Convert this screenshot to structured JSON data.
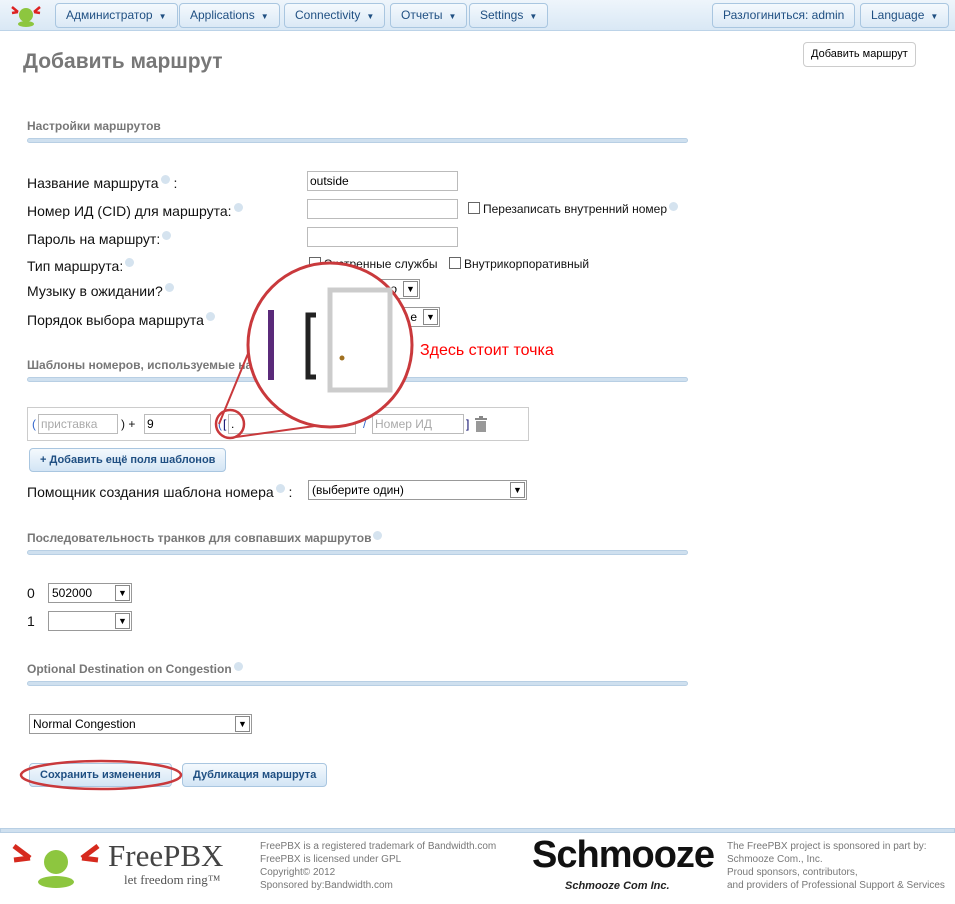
{
  "nav": {
    "items": [
      "Администратор",
      "Applications",
      "Connectivity",
      "Отчеты",
      "Settings"
    ],
    "logout": "Разлогиниться: admin",
    "language": "Language"
  },
  "page": {
    "title": "Добавить маршрут",
    "add_button": "Добавить маршрут"
  },
  "settings": {
    "section": "Настройки маршрутов",
    "name_label": "Название маршрута",
    "name_suffix": ":",
    "name_value": "outside",
    "cid_label": "Номер ИД (CID) для маршрута:",
    "override_label": "Перезаписать внутренний номер",
    "password_label": "Пароль на маршрут:",
    "type_label": "Тип маршрута:",
    "emergency_label": "Экстренные службы",
    "intracompany_label": "Внутрикорпоративный",
    "moh_label": "Музыку в ожидании?",
    "moh_value": "о",
    "order_label": "Порядок выбора маршрута",
    "order_value": "е"
  },
  "patterns": {
    "section": "Шаблоны номеров, используемые на э",
    "open_paren": "(",
    "prefix_placeholder": "приставка",
    "close_plus": ") +",
    "prepend_value": "9",
    "open_bracket": "[",
    "match_value": ".",
    "slash": "/",
    "cid_placeholder": "Номер ИД",
    "close_bracket": "]",
    "add_more": "+ Добавить ещё поля шаблонов",
    "wizard_label": "Помощник создания шаблона номера",
    "wizard_suffix": ":",
    "wizard_value": "(выберите один)"
  },
  "annotation": {
    "text": "Здесь стоит точка",
    "color": "#ff0000"
  },
  "trunks": {
    "section": "Последовательность транков для совпавших маршрутов",
    "rows": [
      {
        "index": "0",
        "value": "502000"
      },
      {
        "index": "1",
        "value": ""
      }
    ]
  },
  "congestion": {
    "section": "Optional Destination on Congestion",
    "value": "Normal Congestion"
  },
  "actions": {
    "save": "Сохранить изменения",
    "duplicate": "Дубликация маршрута"
  },
  "footer": {
    "freepbx_logo": "FreePBX",
    "tagline": "let freedom ring™",
    "lines1": [
      "FreePBX is a registered trademark of Bandwidth.com",
      "FreePBX is licensed under GPL",
      "Copyright© 2012",
      "Sponsored by:Bandwidth.com"
    ],
    "schmooze_logo": "Schmooze",
    "schmooze_sub": "Schmooze Com Inc.",
    "lines2": [
      "The FreePBX project is sponsored in part by:",
      "Schmooze Com., Inc.",
      "Proud sponsors, contributors,",
      "and providers of Professional Support & Services"
    ]
  }
}
